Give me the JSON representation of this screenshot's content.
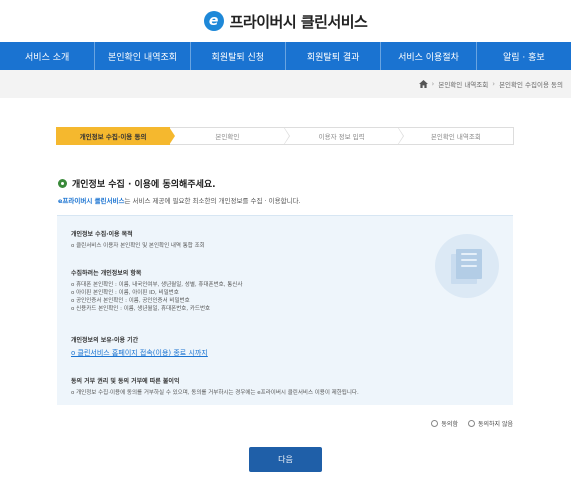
{
  "app": {
    "logo_letter": "e",
    "title": "프라이버시 클린서비스"
  },
  "nav": {
    "items": [
      {
        "label": "서비스 소개"
      },
      {
        "label": "본인확인 내역조회"
      },
      {
        "label": "회원탈퇴 신청"
      },
      {
        "label": "회원탈퇴 결과"
      },
      {
        "label": "서비스 이용절차"
      },
      {
        "label": "알림 · 홍보"
      }
    ]
  },
  "breadcrumb": {
    "items": [
      "본인확인 내역조회",
      "본인확인 수집이용 동의"
    ]
  },
  "steps": [
    {
      "label": "개인정보 수집·이용 동의",
      "active": true
    },
    {
      "label": "본인확인",
      "active": false
    },
    {
      "label": "이용자 정보 입력",
      "active": false
    },
    {
      "label": "본인확인 내역조회",
      "active": false
    }
  ],
  "section": {
    "title": "개인정보 수집 · 이용에 동의해주세요.",
    "intro_brand": "e프라이버시 클린서비스",
    "intro_rest": "는 서비스 제공에 필요한 최소한의 개인정보를 수집 · 이용합니다."
  },
  "panel": {
    "purpose_title": "개인정보 수집·이용 목적",
    "purpose_text": "o 클린서비스 이용자 본인확인 및 본인확인 내역 통합 조회",
    "items_title": "수집하려는 개인정보의 항목",
    "items": [
      "o 휴대폰 본인확인 : 이름, 내국인여부, 생년월일, 성별, 휴대폰번호, 통신사",
      "o 아이핀 본인확인 : 이름, 아이핀 ID, 비밀번호",
      "o 공인인증서 본인확인 : 이름, 공인인증서 비밀번호",
      "o 신용카드 본인확인 : 이름, 생년월일, 휴대폰번호, 카드번호"
    ],
    "retention_title": "개인정보의 보유·이용 기간",
    "retention_text": "o 클린서비스 홈페이지 접속(이용) 종료 시까지",
    "refusal_title": "동의 거부 권리 및 동의 거부에 따른 불이익",
    "refusal_text": "o 개인정보 수집·이용에 동의를 거부하실 수 있으며, 동의를 거부하시는 경우에는 e프라이버시 클린서비스 이용이 제한됩니다."
  },
  "consent": {
    "agree_label": "동의함",
    "disagree_label": "동의하지 않음"
  },
  "next_button": "다음",
  "colors": {
    "brand_blue": "#1a73d1",
    "step_active": "#f5b82e",
    "button": "#1f5fa8",
    "panel_bg": "#eef5fb"
  }
}
